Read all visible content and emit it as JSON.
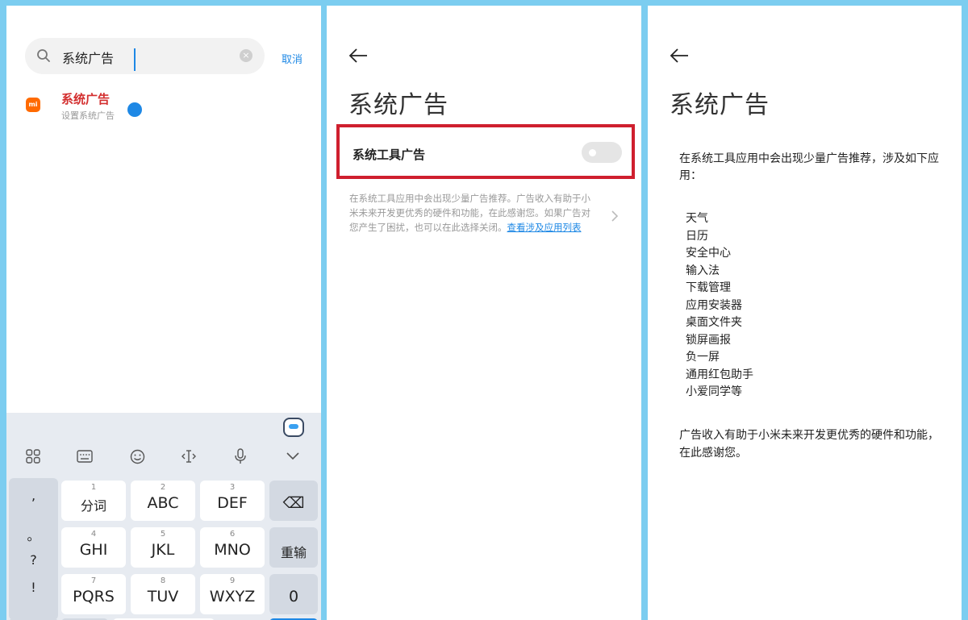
{
  "search_screen": {
    "query": "系统广告",
    "cancel_label": "取消",
    "clear_icon": "×",
    "result": {
      "icon_text": "mi",
      "title": "系统广告",
      "subtitle": "设置系统广告"
    },
    "keyboard": {
      "punctuation": [
        ",",
        "。",
        "?",
        "!"
      ],
      "rows": [
        [
          {
            "num": "1",
            "label": "分词"
          },
          {
            "num": "2",
            "label": "ABC"
          },
          {
            "num": "3",
            "label": "DEF"
          },
          {
            "num": "",
            "label": "⌫"
          }
        ],
        [
          {
            "num": "4",
            "label": "GHI"
          },
          {
            "num": "5",
            "label": "JKL"
          },
          {
            "num": "6",
            "label": "MNO"
          },
          {
            "num": "",
            "label": "重输"
          }
        ],
        [
          {
            "num": "7",
            "label": "PQRS"
          },
          {
            "num": "8",
            "label": "TUV"
          },
          {
            "num": "9",
            "label": "WXYZ"
          },
          {
            "num": "",
            "label": "0"
          }
        ]
      ],
      "toolbar_icons": [
        "grid-icon",
        "keyboard-icon",
        "emoji-icon",
        "cursor-move-icon",
        "microphone-icon",
        "collapse-icon"
      ]
    }
  },
  "settings_screen": {
    "title": "系统广告",
    "toggle_label": "系统工具广告",
    "toggle_on": false,
    "description": "在系统工具应用中会出现少量广告推荐。广告收入有助于小米未来开发更优秀的硬件和功能，在此感谢您。如果广告对您产生了困扰，也可以在此选择关闭。",
    "link_text": "查看涉及应用列表"
  },
  "app_list_screen": {
    "title": "系统广告",
    "intro": "在系统工具应用中会出现少量广告推荐，涉及如下应用：",
    "apps": [
      "天气",
      "日历",
      "安全中心",
      "输入法",
      "下载管理",
      "应用安装器",
      "桌面文件夹",
      "锁屏画报",
      "负一屏",
      "通用红包助手",
      "小爱同学等"
    ],
    "outro": "广告收入有助于小米未来开发更优秀的硬件和功能，在此感谢您。"
  },
  "colors": {
    "frame": "#7ccdf0",
    "accent": "#1e88e5",
    "highlight_border": "#cf1f2e",
    "result_title": "#d32f2f"
  }
}
